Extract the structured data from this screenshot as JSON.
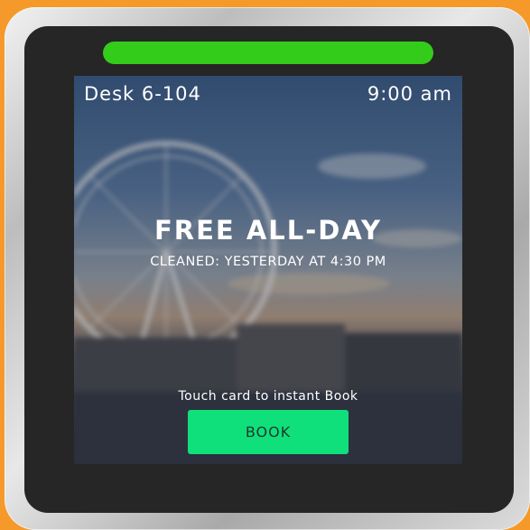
{
  "desk": {
    "name": "Desk 6-104",
    "time": "9:00 am"
  },
  "status": {
    "availability": "FREE ALL-DAY",
    "cleaned": "CLEANED: YESTERDAY AT 4:30 PM",
    "color": "#33cc1a"
  },
  "action": {
    "hint": "Touch card to instant Book",
    "book_label": "BOOK",
    "button_color": "#0fe07c"
  },
  "colors": {
    "frame": "#f59a2a",
    "device": "#262626"
  }
}
